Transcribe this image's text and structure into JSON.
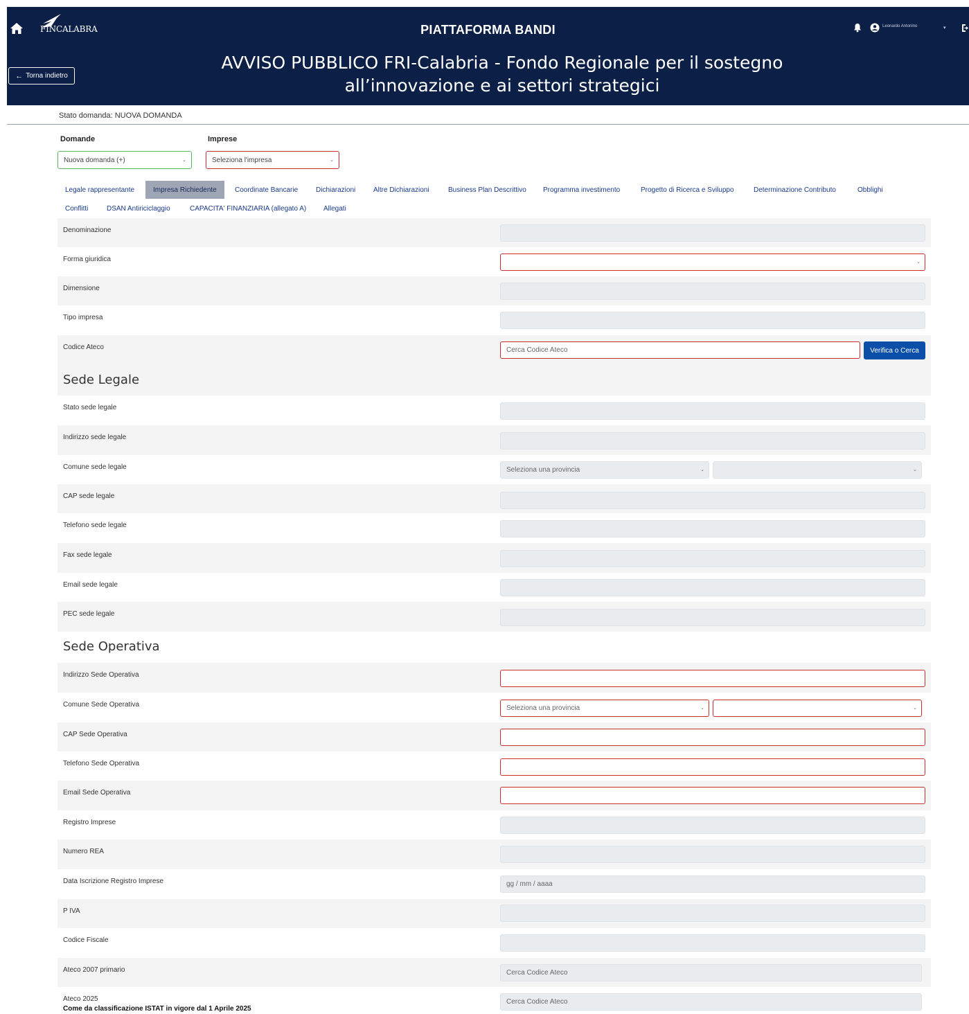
{
  "header": {
    "logo_text": "FINCALABRA",
    "platform_title": "PIATTAFORMA BANDI",
    "title_line1": "AVVISO PUBBLICO FRI-Calabria - Fondo Regionale per il sostegno",
    "title_line2": "all’innovazione e ai settori strategici",
    "back_label": "Torna indietro",
    "user_name": "Leonardo Antonino",
    "user_caret": "▾"
  },
  "status": {
    "text": "Stato domanda: NUOVA DOMANDA"
  },
  "selectors": {
    "domande_label": "Domande",
    "domande_value": "Nuova domanda (+)",
    "imprese_label": "Imprese",
    "imprese_value": "Seleziona l'impresa"
  },
  "tabs": [
    {
      "label": "Legale rappresentante"
    },
    {
      "label": "Impresa Richiedente"
    },
    {
      "label": "Coordinate Bancarie"
    },
    {
      "label": "Dichiarazioni"
    },
    {
      "label": "Altre Dichiarazioni"
    },
    {
      "label": "Business Plan Descrittivo"
    },
    {
      "label": "Programma investimento"
    },
    {
      "label": "Progetto di Ricerca e Sviluppo"
    },
    {
      "label": "Determinazione Contributo"
    },
    {
      "label": "Obblighi"
    },
    {
      "label": "Conflitti"
    },
    {
      "label": "DSAN Antiriciclaggio"
    },
    {
      "label": "CAPACITA' FINANZIARIA (allegato A)"
    },
    {
      "label": "Allegati"
    }
  ],
  "form": {
    "denominazione": "Denominazione",
    "forma_giuridica": "Forma giuridica",
    "dimensione": "Dimensione",
    "tipo_impresa": "Tipo impresa",
    "codice_ateco": "Codice Ateco",
    "codice_ateco_placeholder": "Cerca Codice Ateco",
    "verifica_label": "Verifica o Cerca",
    "sede_legale_title": "Sede Legale",
    "stato_sede_legale": "Stato sede legale",
    "indirizzo_sede_legale": "Indirizzo sede legale",
    "comune_sede_legale": "Comune sede legale",
    "seleziona_provincia": "Seleziona una provincia",
    "cap_sede_legale": "CAP sede legale",
    "telefono_sede_legale": "Telefono sede legale",
    "fax_sede_legale": "Fax sede legale",
    "email_sede_legale": "Email sede legale",
    "pec_sede_legale": "PEC sede legale",
    "sede_operativa_title": "Sede Operativa",
    "indirizzo_sede_operativa": "Indirizzo Sede Operativa",
    "comune_sede_operativa": "Comune Sede Operativa",
    "cap_sede_operativa": "CAP Sede Operativa",
    "telefono_sede_operativa": "Telefono Sede Operativa",
    "email_sede_operativa": "Email Sede Operativa",
    "registro_imprese": "Registro Imprese",
    "numero_rea": "Numero REA",
    "data_iscrizione": "Data Iscrizione Registro Imprese",
    "date_placeholder": "gg / mm / aaaa",
    "p_iva": "P IVA",
    "codice_fiscale": "Codice Fiscale",
    "ateco_2007": "Ateco 2007 primario",
    "ateco_2025": "Ateco 2025",
    "ateco_2025_note": "Come da classificazione ISTAT in vigore dal 1 Aprile 2025"
  },
  "colors": {
    "header_bg": "#0c1f46",
    "tab_link": "#1a3a8a",
    "error_border": "#c9302c",
    "primary_button": "#0b4fa8"
  }
}
